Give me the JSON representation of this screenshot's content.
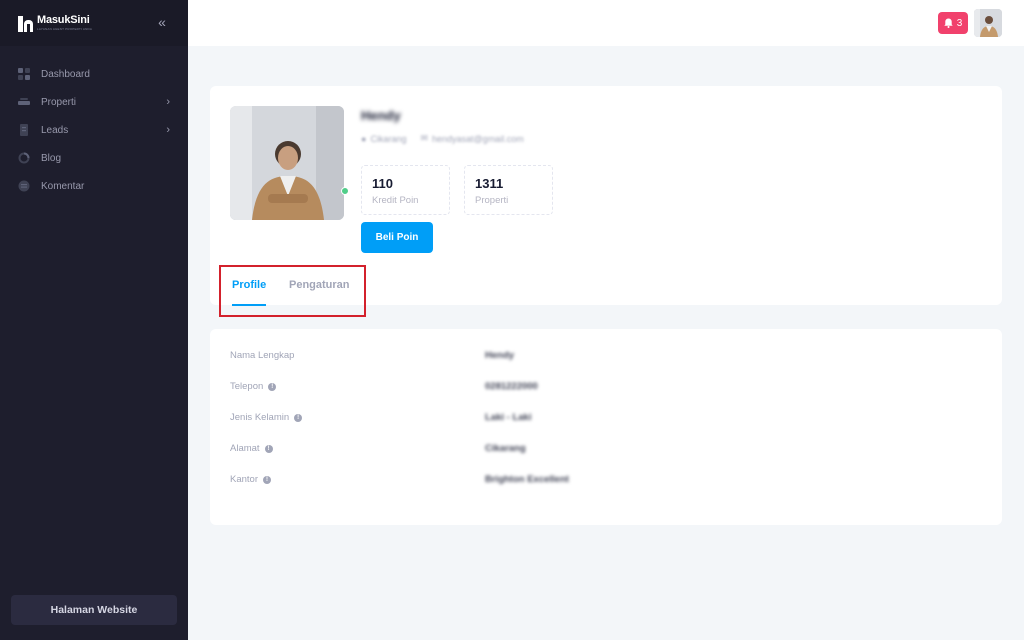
{
  "brand": {
    "name": "MasukSini",
    "tagline": "LAYANAN AGENT PROPERTI ANDA"
  },
  "sidebar": {
    "items": [
      {
        "label": "Dashboard",
        "icon": "dashboard-icon"
      },
      {
        "label": "Properti",
        "icon": "property-icon",
        "has_submenu": true
      },
      {
        "label": "Leads",
        "icon": "leads-icon",
        "has_submenu": true
      },
      {
        "label": "Blog",
        "icon": "blog-icon"
      },
      {
        "label": "Komentar",
        "icon": "comment-icon"
      }
    ],
    "website_button": "Halaman Website"
  },
  "header": {
    "notification_count": "3"
  },
  "profile": {
    "name": "Hendy",
    "location": "Cikarang",
    "email": "hendyasat@gmail.com",
    "stats": [
      {
        "value": "110",
        "label": "Kredit Poin"
      },
      {
        "value": "1311",
        "label": "Properti"
      }
    ],
    "buy_button": "Beli Poin",
    "tabs": [
      "Profile",
      "Pengaturan"
    ],
    "active_tab": "Profile"
  },
  "details": [
    {
      "label": "Nama Lengkap",
      "value": "Hendy",
      "info": false
    },
    {
      "label": "Telepon",
      "value": "0281222000",
      "info": true
    },
    {
      "label": "Jenis Kelamin",
      "value": "Laki - Laki",
      "info": true
    },
    {
      "label": "Alamat",
      "value": "Cikarang",
      "info": true
    },
    {
      "label": "Kantor",
      "value": "Brighton Excellent",
      "info": true
    }
  ],
  "colors": {
    "sidebar_bg": "#1e1e2d",
    "accent": "#009ef7",
    "notification": "#f1416c",
    "highlight_box": "#d3212c",
    "online": "#50cd89"
  }
}
